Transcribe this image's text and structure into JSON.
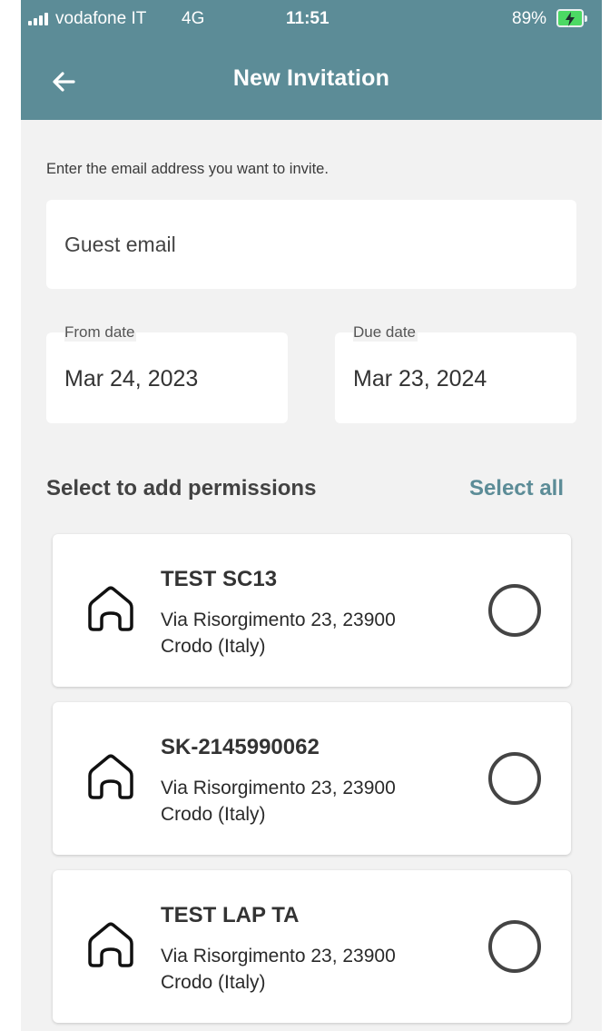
{
  "status_bar": {
    "carrier": "vodafone IT",
    "network": "4G",
    "time": "11:51",
    "battery": "89%",
    "battery_color": "#4cd964"
  },
  "app_bar": {
    "title": "New Invitation",
    "back_icon": "arrow-left-icon",
    "background": "#5c8c97"
  },
  "form": {
    "instruction": "Enter the email address you want to invite.",
    "email_placeholder": "Guest email",
    "from_date": {
      "label": "From date",
      "value": "Mar 24, 2023"
    },
    "due_date": {
      "label": "Due date",
      "value": "Mar 23, 2024"
    }
  },
  "permissions": {
    "heading": "Select to add permissions",
    "select_all": "Select all",
    "items": [
      {
        "name": "TEST SC13",
        "address_line1": "Via Risorgimento 23, 23900",
        "address_line2": "Crodo (Italy)",
        "icon": "home-icon",
        "selected": false
      },
      {
        "name": "SK-2145990062",
        "address_line1": "Via Risorgimento 23, 23900",
        "address_line2": "Crodo (Italy)",
        "icon": "home-icon",
        "selected": false
      },
      {
        "name": "TEST LAP TA",
        "address_line1": "Via Risorgimento 23, 23900",
        "address_line2": "Crodo (Italy)",
        "icon": "home-icon",
        "selected": false
      }
    ]
  }
}
